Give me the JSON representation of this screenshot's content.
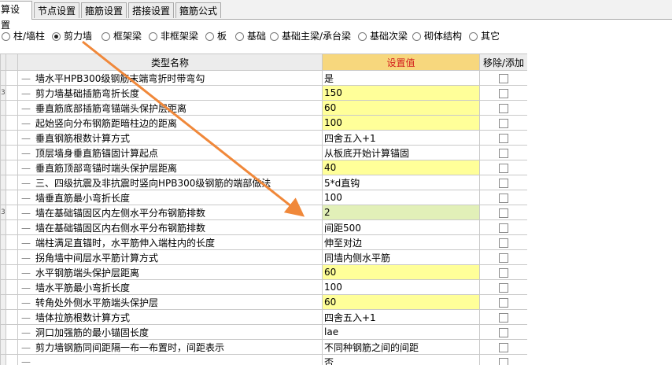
{
  "tabs": [
    {
      "label": "算设置",
      "active": true
    },
    {
      "label": "节点设置",
      "active": false
    },
    {
      "label": "箍筋设置",
      "active": false
    },
    {
      "label": "搭接设置",
      "active": false
    },
    {
      "label": "箍筋公式",
      "active": false
    }
  ],
  "radios": [
    {
      "label": "柱/墙柱",
      "checked": false
    },
    {
      "label": "剪力墙",
      "checked": true
    },
    {
      "label": "框架梁",
      "checked": false
    },
    {
      "label": "非框架梁",
      "checked": false
    },
    {
      "label": "板",
      "checked": false
    },
    {
      "label": "基础",
      "checked": false
    },
    {
      "label": "基础主梁/承台梁",
      "checked": false
    },
    {
      "label": "基础次梁",
      "checked": false
    },
    {
      "label": "砌体结构",
      "checked": false
    },
    {
      "label": "其它",
      "checked": false
    }
  ],
  "table": {
    "headers": {
      "name": "类型名称",
      "value": "设置值",
      "toggle": "移除/添加"
    },
    "rows": [
      {
        "idx": "",
        "name": "墙水平HPB300级钢筋末端弯折时带弯勾",
        "value": "是",
        "style": "plain"
      },
      {
        "idx": "3",
        "name": "剪力墙基础插筋弯折长度",
        "value": "150",
        "style": "yellow"
      },
      {
        "idx": "",
        "name": "垂直筋底部插筋弯锚端头保护层距离",
        "value": "60",
        "style": "yellow"
      },
      {
        "idx": "",
        "name": "起始竖向分布钢筋距暗柱边的距离",
        "value": "100",
        "style": "yellow"
      },
      {
        "idx": "",
        "name": "垂直钢筋根数计算方式",
        "value": "四舍五入+1",
        "style": "plain"
      },
      {
        "idx": "",
        "name": "顶层墙身垂直筋锚固计算起点",
        "value": "从板底开始计算锚固",
        "style": "plain"
      },
      {
        "idx": "",
        "name": "垂直筋顶部弯锚时端头保护层距离",
        "value": "40",
        "style": "yellow"
      },
      {
        "idx": "",
        "name": "三、四级抗震及非抗震时竖向HPB300级钢筋的端部做法",
        "value": "5*d直钩",
        "style": "plain"
      },
      {
        "idx": "",
        "name": "墙垂直筋最小弯折长度",
        "value": "100",
        "style": "plain"
      },
      {
        "idx": "3",
        "name": "墙在基础锚固区内左侧水平分布钢筋排数",
        "value": "2",
        "style": "selected"
      },
      {
        "idx": "",
        "name": "墙在基础锚固区内右侧水平分布钢筋排数",
        "value": "间距500",
        "style": "plain"
      },
      {
        "idx": "",
        "name": "端柱满足直锚时，水平筋伸入端柱内的长度",
        "value": "伸至对边",
        "style": "plain"
      },
      {
        "idx": "",
        "name": "拐角墙中间层水平筋计算方式",
        "value": "同墙内侧水平筋",
        "style": "plain"
      },
      {
        "idx": "",
        "name": "水平钢筋端头保护层距离",
        "value": "60",
        "style": "yellow"
      },
      {
        "idx": "",
        "name": "墙水平筋最小弯折长度",
        "value": "100",
        "style": "plain"
      },
      {
        "idx": "",
        "name": "转角处外侧水平筋端头保护层",
        "value": "60",
        "style": "yellow"
      },
      {
        "idx": "",
        "name": "墙体拉筋根数计算方式",
        "value": "四舍五入+1",
        "style": "plain"
      },
      {
        "idx": "",
        "name": "洞口加强筋的最小锚固长度",
        "value": "lae",
        "style": "plain"
      },
      {
        "idx": "",
        "name": "剪力墙钢筋同间距隔一布一布置时，间距表示",
        "value": "不同种钢筋之间的间距",
        "style": "plain"
      },
      {
        "idx": "",
        "name": "",
        "value": "否",
        "style": "plain"
      }
    ]
  },
  "colors": {
    "arrow": "#f0883a",
    "header_value_bg": "#f7d77d",
    "header_value_text": "#d31d1d",
    "yellow_cell": "#ffff99",
    "selected_cell": "#e2f0b8"
  }
}
